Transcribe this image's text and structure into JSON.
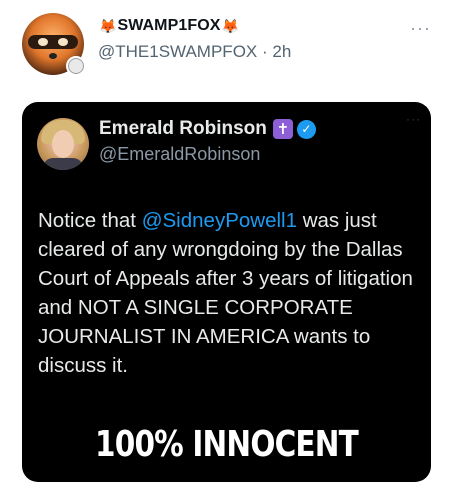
{
  "post": {
    "display_name": "SWAMP1FOX",
    "name_emoji_left": "🦊",
    "name_emoji_right": "🦊",
    "handle": "@THE1SWAMPFOX",
    "separator": "·",
    "time": "2h",
    "more_label": "···"
  },
  "media": {
    "embedded_tweet": {
      "author_name": "Emerald Robinson",
      "badge_cross": "✝",
      "verified_check": "✓",
      "handle": "@EmeraldRobinson",
      "more_label": "···",
      "text_before": "Notice that ",
      "mention": "@SidneyPowell1",
      "text_after": " was just cleared of any wrongdoing by the Dallas Court of Appeals after 3 years of litigation and NOT A SINGLE CORPORATE JOURNALIST IN AMERICA wants to discuss it."
    },
    "caption": "100% INNOCENT"
  },
  "colors": {
    "link_blue": "#1d9bf0",
    "muted_gray": "#536471",
    "media_bg": "#000000",
    "cross_badge_purple": "#8c5fd6"
  },
  "icons": [
    "fox-emoji",
    "more-icon",
    "cross-badge-icon",
    "verified-icon"
  ]
}
